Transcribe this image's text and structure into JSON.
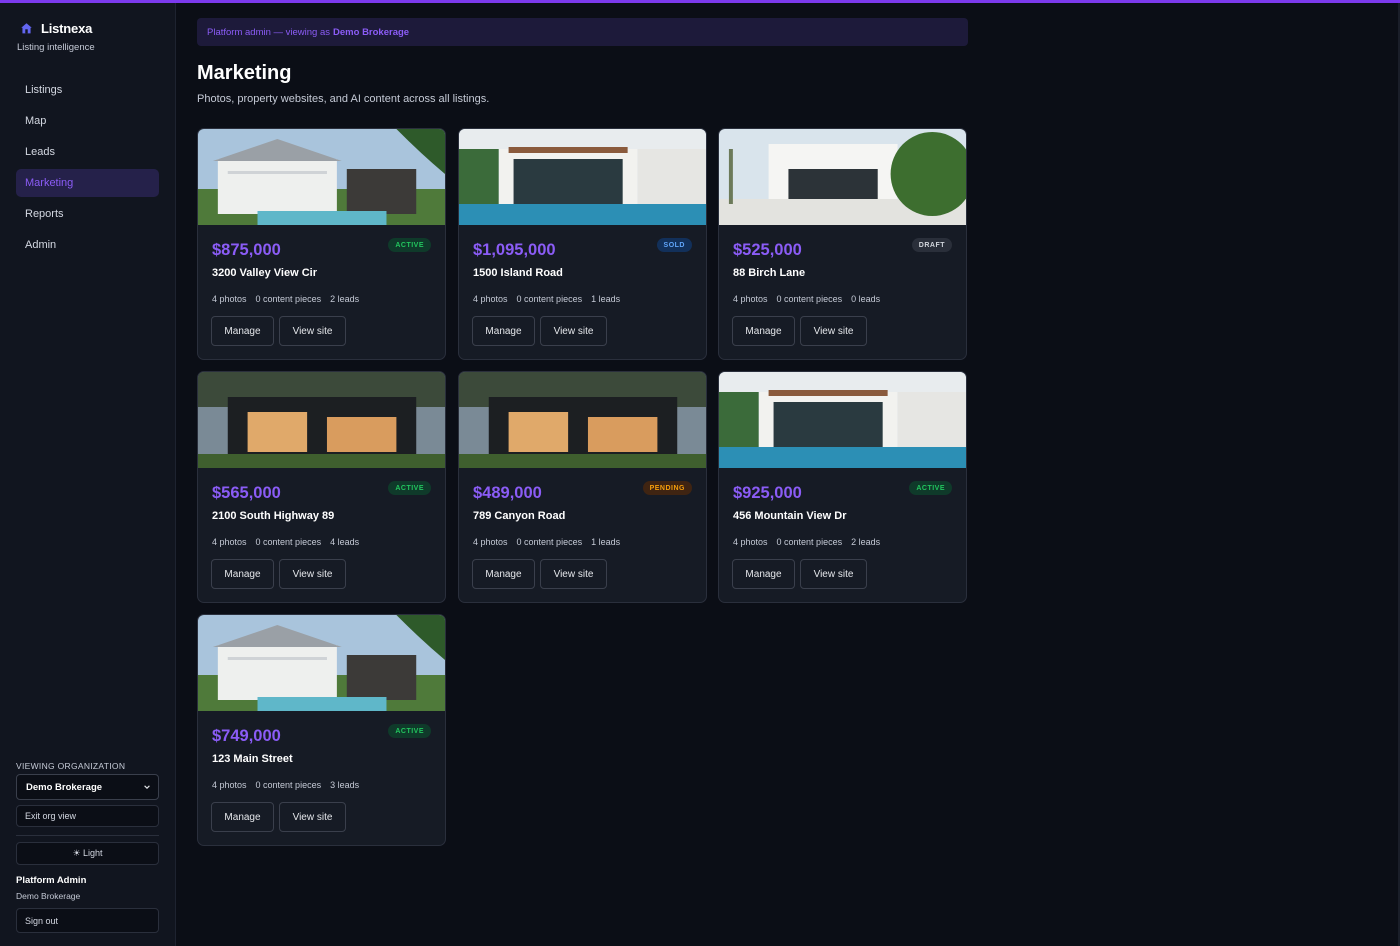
{
  "app": {
    "name": "Listnexa",
    "tagline": "Listing intelligence"
  },
  "nav": [
    {
      "label": "Listings",
      "active": false
    },
    {
      "label": "Map",
      "active": false
    },
    {
      "label": "Leads",
      "active": false
    },
    {
      "label": "Marketing",
      "active": true
    },
    {
      "label": "Reports",
      "active": false
    },
    {
      "label": "Admin",
      "active": false
    }
  ],
  "sidebar_footer": {
    "org_label": "VIEWING ORGANIZATION",
    "org_selected": "Demo Brokerage",
    "exit_label": "Exit org view",
    "theme_label": "☀ Light",
    "user_name": "Platform Admin",
    "user_org": "Demo Brokerage",
    "signout_label": "Sign out"
  },
  "banner": {
    "prefix": "Platform admin — viewing as",
    "org": "Demo Brokerage"
  },
  "page": {
    "title": "Marketing",
    "subtitle": "Photos, property websites, and AI content across all listings."
  },
  "card_actions": {
    "manage": "Manage",
    "view": "View site"
  },
  "listings": [
    {
      "price": "$875,000",
      "status": "ACTIVE",
      "address": "3200 Valley View Cir",
      "photos": "4 photos",
      "content": "0 content pieces",
      "leads": "2 leads",
      "image": "house-colonial-icon"
    },
    {
      "price": "$1,095,000",
      "status": "SOLD",
      "address": "1500 Island Road",
      "photos": "4 photos",
      "content": "0 content pieces",
      "leads": "1 leads",
      "image": "house-modern-pool-icon"
    },
    {
      "price": "$525,000",
      "status": "DRAFT",
      "address": "88 Birch Lane",
      "photos": "4 photos",
      "content": "0 content pieces",
      "leads": "0 leads",
      "image": "house-modern-white-icon"
    },
    {
      "price": "$565,000",
      "status": "ACTIVE",
      "address": "2100 South Highway 89",
      "photos": "4 photos",
      "content": "0 content pieces",
      "leads": "4 leads",
      "image": "house-modern-dark-icon"
    },
    {
      "price": "$489,000",
      "status": "PENDING",
      "address": "789 Canyon Road",
      "photos": "4 photos",
      "content": "0 content pieces",
      "leads": "1 leads",
      "image": "house-modern-dark-icon"
    },
    {
      "price": "$925,000",
      "status": "ACTIVE",
      "address": "456 Mountain View Dr",
      "photos": "4 photos",
      "content": "0 content pieces",
      "leads": "2 leads",
      "image": "house-modern-pool-icon"
    },
    {
      "price": "$749,000",
      "status": "ACTIVE",
      "address": "123 Main Street",
      "photos": "4 photos",
      "content": "0 content pieces",
      "leads": "3 leads",
      "image": "house-colonial-icon"
    }
  ],
  "colors": {
    "accent": "#8b5cf6",
    "background": "#0b0e16",
    "card": "#161b25",
    "active": "#22c55e",
    "sold": "#60a5fa",
    "pending": "#f59e0b"
  }
}
